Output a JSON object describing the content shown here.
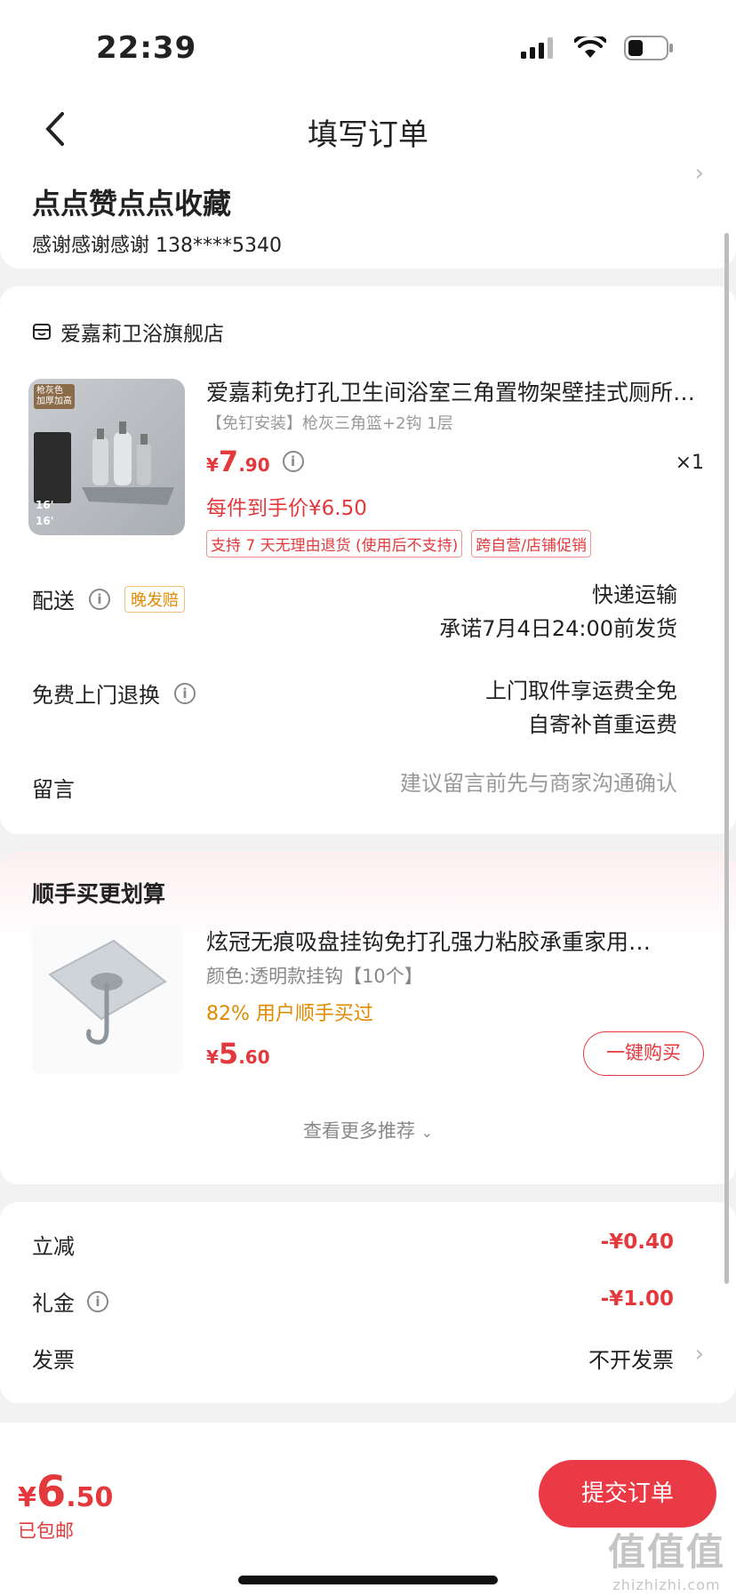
{
  "status_bar": {
    "time": "22:39"
  },
  "nav": {
    "title": "填写订单"
  },
  "address": {
    "name": "点点赞点点收藏",
    "detail": "感谢感谢感谢  138****5340"
  },
  "shop": {
    "name": "爱嘉莉卫浴旗舰店",
    "product": {
      "title": "爱嘉莉免打孔卫生间浴室三角置物架壁挂式厕所…",
      "spec": "【免钉安装】枪灰三角篮+2钩 1层",
      "price_currency": "¥",
      "price_int": "7",
      "price_dec": ".90",
      "quantity": "×1",
      "final_price": "每件到手价¥6.50",
      "tags": [
        "支持 7 天无理由退货 (使用后不支持)",
        "跨自营/店铺促销"
      ],
      "image_labels": {
        "badge": "枪灰色 加厚加高",
        "size1": "16'",
        "size2": "16'"
      }
    },
    "delivery": {
      "label": "配送",
      "tag": "晚发赔",
      "method": "快递运输",
      "promise": "承诺7月4日24:00前发货"
    },
    "return": {
      "label": "免费上门退换",
      "line1": "上门取件享运费全免",
      "line2": "自寄补首重运费"
    },
    "message": {
      "label": "留言",
      "placeholder": "建议留言前先与商家沟通确认"
    }
  },
  "upsell": {
    "title": "顺手买更划算",
    "item": {
      "title": "炫冠无痕吸盘挂钩免打孔强力粘胶承重家用…",
      "spec": "颜色:透明款挂钩【10个】",
      "percent": "82% 用户顺手买过",
      "price_currency": "¥",
      "price_int": "5",
      "price_dec": ".60",
      "buy_label": "一键购买"
    },
    "more_label": "查看更多推荐"
  },
  "discounts": {
    "instant_label": "立减",
    "instant_value": "-¥0.40",
    "gift_label": "礼金",
    "gift_value": "-¥1.00",
    "invoice_label": "发票",
    "invoice_value": "不开发票"
  },
  "footer": {
    "total_currency": "¥",
    "total_int": "6",
    "total_dec": ".50",
    "shipping": "已包邮",
    "submit_label": "提交订单"
  },
  "watermark": {
    "big": "值值值",
    "small": "zhizhizhi.com"
  },
  "colors": {
    "accent": "#e4393c",
    "submit_bg": "#ea3a46",
    "warning": "#e08a00"
  }
}
